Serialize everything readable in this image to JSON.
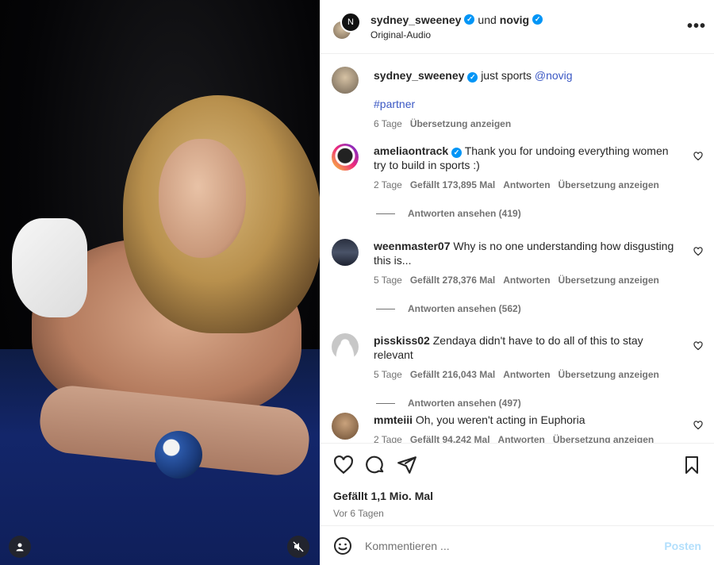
{
  "header": {
    "user1": "sydney_sweeney",
    "joiner": "und",
    "user2": "novig",
    "audio": "Original-Audio",
    "more": "•••"
  },
  "caption": {
    "user": "sydney_sweeney",
    "text": "just sports",
    "mention": "@novig",
    "hashtag": "#partner",
    "time": "6 Tage",
    "translate": "Übersetzung anzeigen"
  },
  "comments": [
    {
      "user": "ameliaontrack",
      "verified": true,
      "text": "Thank you for undoing everything women try to build in sports :)",
      "time": "2 Tage",
      "likes": "Gefällt 173,895 Mal",
      "reply": "Antworten",
      "translate": "Übersetzung anzeigen",
      "view_replies": "Antworten ansehen (419)"
    },
    {
      "user": "weenmaster07",
      "verified": false,
      "text": "Why is no one understanding how disgusting this is...",
      "time": "5 Tage",
      "likes": "Gefällt 278,376 Mal",
      "reply": "Antworten",
      "translate": "Übersetzung anzeigen",
      "view_replies": "Antworten ansehen (562)"
    },
    {
      "user": "pisskiss02",
      "verified": false,
      "text": "Zendaya didn't have to do all of this to stay relevant",
      "time": "5 Tage",
      "likes": "Gefällt 216,043 Mal",
      "reply": "Antworten",
      "translate": "Übersetzung anzeigen",
      "view_replies": "Antworten ansehen (497)"
    },
    {
      "user": "mmteiii",
      "verified": false,
      "text": "Oh, you weren't acting in Euphoria",
      "time": "2 Tage",
      "likes": "Gefällt 94,242 Mal",
      "reply": "Antworten",
      "translate": "Übersetzung anzeigen"
    }
  ],
  "post": {
    "likes": "Gefällt 1,1 Mio. Mal",
    "date": "Vor 6 Tagen"
  },
  "composer": {
    "placeholder": "Kommentieren ...",
    "post_label": "Posten"
  },
  "colors": {
    "verified": "#0095f6",
    "link": "#3b58c4",
    "post_disabled": "#b2dffc"
  }
}
